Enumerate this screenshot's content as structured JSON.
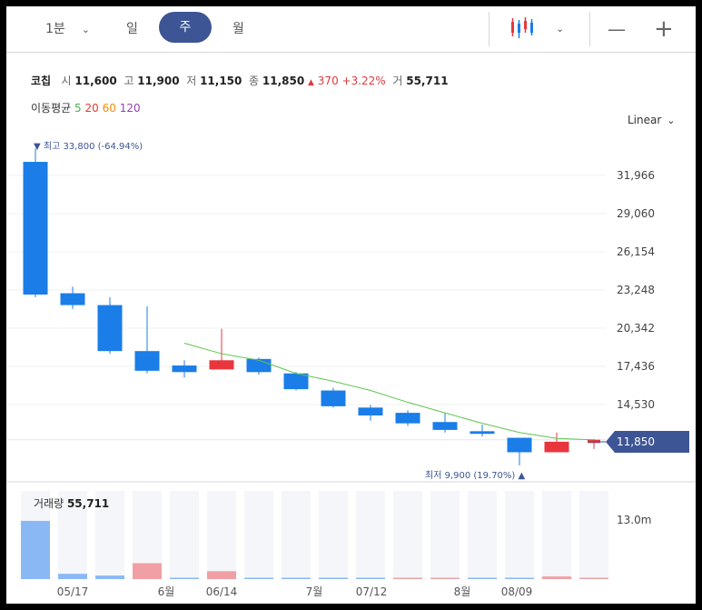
{
  "toolbar": {
    "interval": "1분",
    "tabs": [
      "일",
      "주",
      "월"
    ],
    "selected_tab": "주",
    "chart_style_icon": "candlestick-icon",
    "zoom_out": "—",
    "zoom_in": "+"
  },
  "stock": {
    "name": "코칩",
    "open_label": "시",
    "open": "11,600",
    "high_label": "고",
    "high": "11,900",
    "low_label": "저",
    "low": "11,150",
    "close_label": "종",
    "close": "11,850",
    "change_arrow": "▲",
    "change": "370",
    "change_pct": "+3.22%",
    "volume_label": "거",
    "volume": "55,711"
  },
  "moving_average": {
    "label": "이동평균",
    "periods": [
      {
        "value": "5",
        "color": "#4caf50"
      },
      {
        "value": "20",
        "color": "#e53935"
      },
      {
        "value": "60",
        "color": "#fb8c00"
      },
      {
        "value": "120",
        "color": "#8e44ad"
      }
    ]
  },
  "scale": "Linear",
  "price_axis": [
    "31,966",
    "29,060",
    "26,154",
    "23,248",
    "20,342",
    "17,436",
    "14,530"
  ],
  "current_price_tag": "11,850",
  "high_marker": "▼ 최고 33,800 (-64.94%)",
  "low_marker": "최저 9,900 (19.70%) ▲",
  "volume_panel": {
    "label": "거래량",
    "value": "55,711",
    "axis": "13.0m"
  },
  "date_axis": [
    "05/17",
    "6월",
    "06/14",
    "7월",
    "07/12",
    "8월",
    "08/09"
  ],
  "colors": {
    "up": "#e8363c",
    "down": "#1a7de8",
    "ma": "#5fc44e",
    "accent": "#3d5595",
    "volume_down": "#8ab8f5",
    "volume_up": "#f0a0a4"
  },
  "chart_data": {
    "type": "candlestick",
    "scale": "linear",
    "ylim": [
      10000,
      34500
    ],
    "candles": [
      {
        "open": 33000,
        "high": 34000,
        "low": 22700,
        "close": 22900,
        "dir": "down"
      },
      {
        "open": 23000,
        "high": 23500,
        "low": 21800,
        "close": 22100,
        "dir": "down"
      },
      {
        "open": 22100,
        "high": 22700,
        "low": 18400,
        "close": 18600,
        "dir": "down"
      },
      {
        "open": 18600,
        "high": 22000,
        "low": 16900,
        "close": 17100,
        "dir": "down"
      },
      {
        "open": 17500,
        "high": 17900,
        "low": 16600,
        "close": 17000,
        "dir": "down"
      },
      {
        "open": 17200,
        "high": 20300,
        "low": 17200,
        "close": 17900,
        "dir": "up"
      },
      {
        "open": 18000,
        "high": 18100,
        "low": 16800,
        "close": 17000,
        "dir": "down"
      },
      {
        "open": 16900,
        "high": 17000,
        "low": 15600,
        "close": 15700,
        "dir": "down"
      },
      {
        "open": 15600,
        "high": 15800,
        "low": 14300,
        "close": 14400,
        "dir": "down"
      },
      {
        "open": 14300,
        "high": 14500,
        "low": 13300,
        "close": 13700,
        "dir": "down"
      },
      {
        "open": 13900,
        "high": 14100,
        "low": 12900,
        "close": 13100,
        "dir": "down"
      },
      {
        "open": 13200,
        "high": 13900,
        "low": 12400,
        "close": 12600,
        "dir": "down"
      },
      {
        "open": 12500,
        "high": 13000,
        "low": 12100,
        "close": 12300,
        "dir": "down"
      },
      {
        "open": 12000,
        "high": 12000,
        "low": 9900,
        "close": 10900,
        "dir": "down"
      },
      {
        "open": 10900,
        "high": 12400,
        "low": 10900,
        "close": 11700,
        "dir": "up"
      },
      {
        "open": 11600,
        "high": 11900,
        "low": 11150,
        "close": 11850,
        "dir": "up"
      }
    ],
    "ma5": [
      {
        "i": 4,
        "v": 19200
      },
      {
        "i": 5,
        "v": 18400
      },
      {
        "i": 6,
        "v": 17900
      },
      {
        "i": 7,
        "v": 16900
      },
      {
        "i": 8,
        "v": 16300
      },
      {
        "i": 9,
        "v": 15600
      },
      {
        "i": 10,
        "v": 14700
      },
      {
        "i": 11,
        "v": 13900
      },
      {
        "i": 12,
        "v": 13100
      },
      {
        "i": 13,
        "v": 12400
      },
      {
        "i": 14,
        "v": 11950
      },
      {
        "i": 15,
        "v": 11850
      }
    ],
    "volume": [
      0.66,
      0.06,
      0.04,
      0.18,
      0.015,
      0.09,
      0.015,
      0.01,
      0.01,
      0.01,
      0.01,
      0.01,
      0.01,
      0.01,
      0.03,
      0.01
    ],
    "volume_dir": [
      "down",
      "down",
      "down",
      "up",
      "down",
      "up",
      "down",
      "down",
      "down",
      "down",
      "up",
      "up",
      "down",
      "down",
      "up",
      "up"
    ],
    "volume_axis_max": "13.0m"
  }
}
